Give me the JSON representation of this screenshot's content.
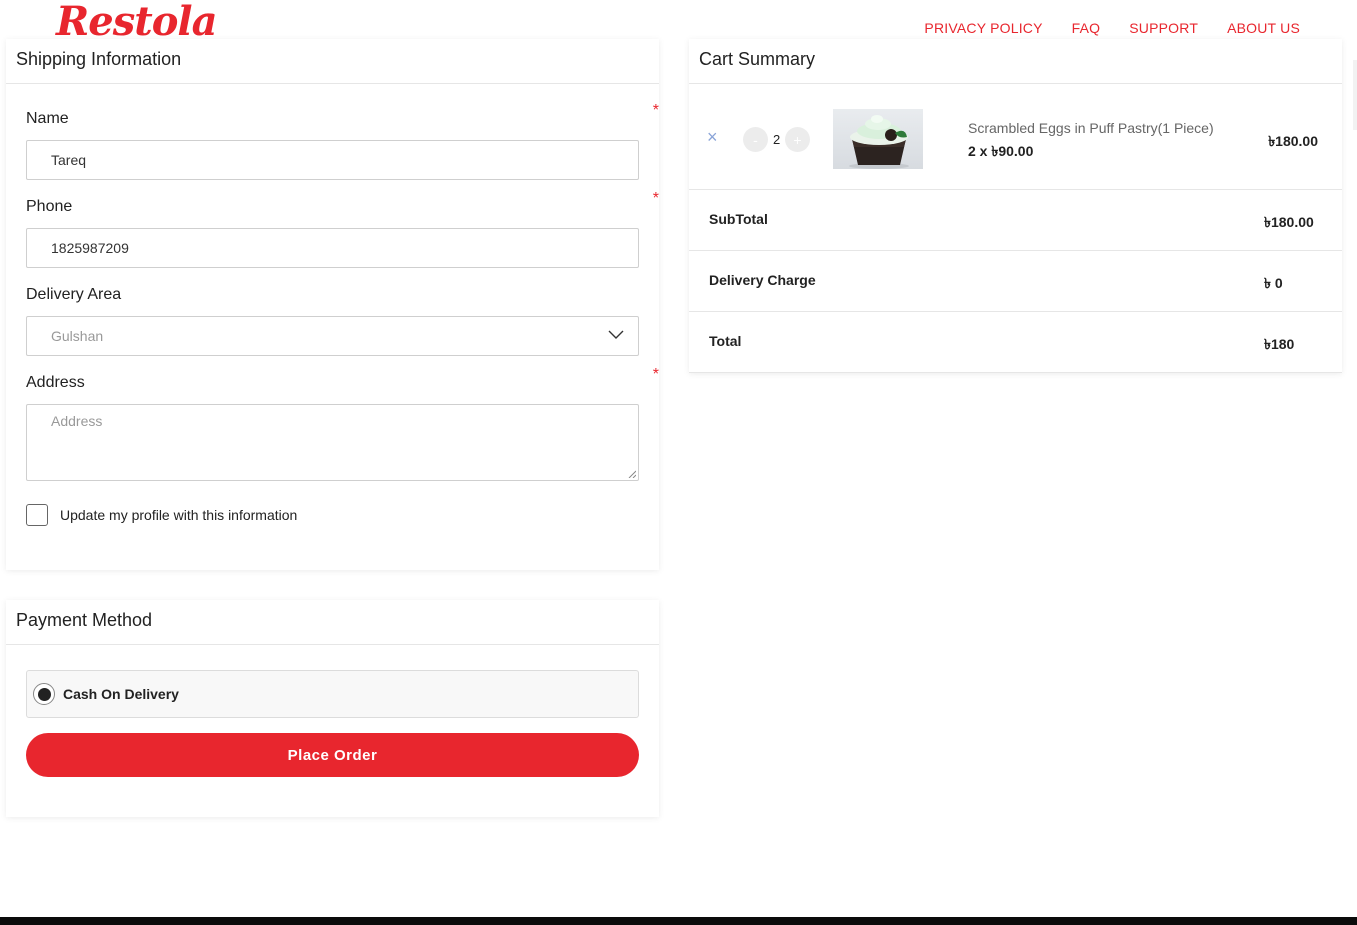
{
  "brand": {
    "logo": "Restola",
    "accent": "#e8262e"
  },
  "nav": [
    {
      "label": "PRIVACY POLICY"
    },
    {
      "label": "FAQ"
    },
    {
      "label": "SUPPORT"
    },
    {
      "label": "ABOUT US"
    }
  ],
  "shipping": {
    "title": "Shipping Information",
    "required_mark": "*",
    "name": {
      "label": "Name",
      "value": "Tareq"
    },
    "phone": {
      "label": "Phone",
      "value": "1825987209"
    },
    "area": {
      "label": "Delivery Area",
      "value": "Gulshan"
    },
    "address": {
      "label": "Address",
      "placeholder": "Address",
      "value": ""
    },
    "update_profile": {
      "label": "Update my profile with this information",
      "checked": false
    }
  },
  "payment": {
    "title": "Payment Method",
    "options": [
      {
        "label": "Cash On Delivery",
        "selected": true
      }
    ],
    "place_order": "Place Order"
  },
  "cart": {
    "title": "Cart Summary",
    "items": [
      {
        "remove": "×",
        "minus": "-",
        "quantity": "2",
        "plus": "+",
        "name": "Scrambled Eggs in Puff Pastry(1 Piece)",
        "unit_line": "2 x ৳90.00",
        "line_total": "৳180.00",
        "image": "cupcake-image"
      }
    ],
    "subtotal": {
      "label": "SubTotal",
      "value": "৳180.00"
    },
    "delivery": {
      "label": "Delivery Charge",
      "value": "৳ 0"
    },
    "total": {
      "label": "Total",
      "value": "৳180"
    }
  }
}
